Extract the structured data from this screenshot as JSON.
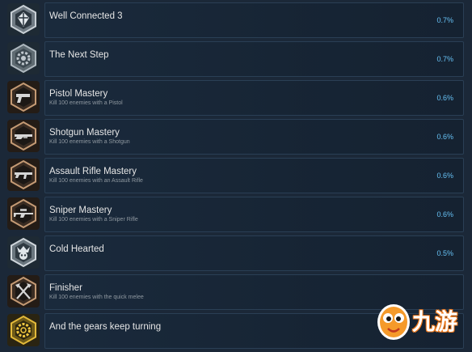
{
  "achievements": [
    {
      "title": "Well Connected 3",
      "description": "",
      "percent": "0.7%",
      "icon": "cross-shield-icon"
    },
    {
      "title": "The Next Step",
      "description": "",
      "percent": "0.7%",
      "icon": "gear-emblem-icon"
    },
    {
      "title": "Pistol Mastery",
      "description": "Kill 100 enemies with a Pistol",
      "percent": "0.6%",
      "icon": "pistol-icon"
    },
    {
      "title": "Shotgun Mastery",
      "description": "Kill 100 enemies with a Shotgun",
      "percent": "0.6%",
      "icon": "shotgun-icon"
    },
    {
      "title": "Assault Rifle Mastery",
      "description": "Kill 100 enemies with an Assault Rifle",
      "percent": "0.6%",
      "icon": "assault-rifle-icon"
    },
    {
      "title": "Sniper Mastery",
      "description": "Kill 100 enemies with a Sniper Rifle",
      "percent": "0.6%",
      "icon": "sniper-rifle-icon"
    },
    {
      "title": "Cold Hearted",
      "description": "",
      "percent": "0.5%",
      "icon": "skull-emblem-icon"
    },
    {
      "title": "Finisher",
      "description": "Kill 100 enemies with the quick melee",
      "percent": "",
      "icon": "crossed-axes-icon"
    },
    {
      "title": "And the gears keep turning",
      "description": "",
      "percent": "",
      "icon": "golden-gear-icon"
    }
  ],
  "watermark": {
    "text": "九游",
    "icon": "mascot-logo"
  },
  "colors": {
    "background": "#1b2838",
    "panel": "#172535",
    "title": "#e6e6e6",
    "description": "#8f98a0",
    "percent": "#66c0f4",
    "hex_frame_silver": "#9aa3ab",
    "hex_frame_bronze": "#b0825a",
    "hex_frame_gold": "#d4a520"
  }
}
